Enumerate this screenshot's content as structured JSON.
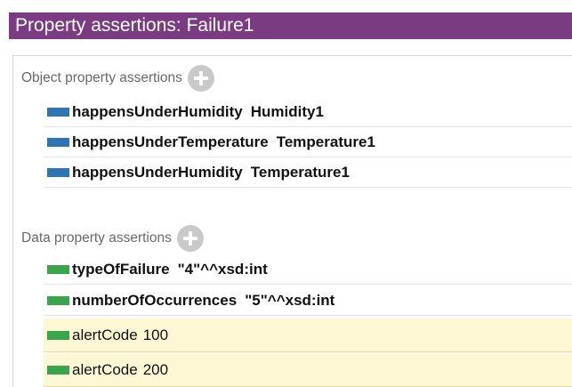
{
  "title": "Property assertions: Failure1",
  "colors": {
    "title_bar": "#7a3b82",
    "object_property_swatch": "#2e75b6",
    "data_property_swatch": "#3aa54a",
    "highlight_row": "#fdf8d3"
  },
  "object_section": {
    "label": "Object property assertions",
    "add_icon": "plus-circle-icon",
    "rows": [
      {
        "property": "happensUnderHumidity",
        "value": "Humidity1"
      },
      {
        "property": "happensUnderTemperature",
        "value": "Temperature1"
      },
      {
        "property": "happensUnderHumidity",
        "value": "Temperature1"
      }
    ]
  },
  "data_section": {
    "label": "Data property assertions",
    "add_icon": "plus-circle-icon",
    "rows": [
      {
        "property": "typeOfFailure",
        "value": "\"4\"^^xsd:int"
      },
      {
        "property": "numberOfOccurrences",
        "value": "\"5\"^^xsd:int"
      },
      {
        "property": "alertCode",
        "value": "100"
      },
      {
        "property": "alertCode",
        "value": "200"
      }
    ]
  }
}
